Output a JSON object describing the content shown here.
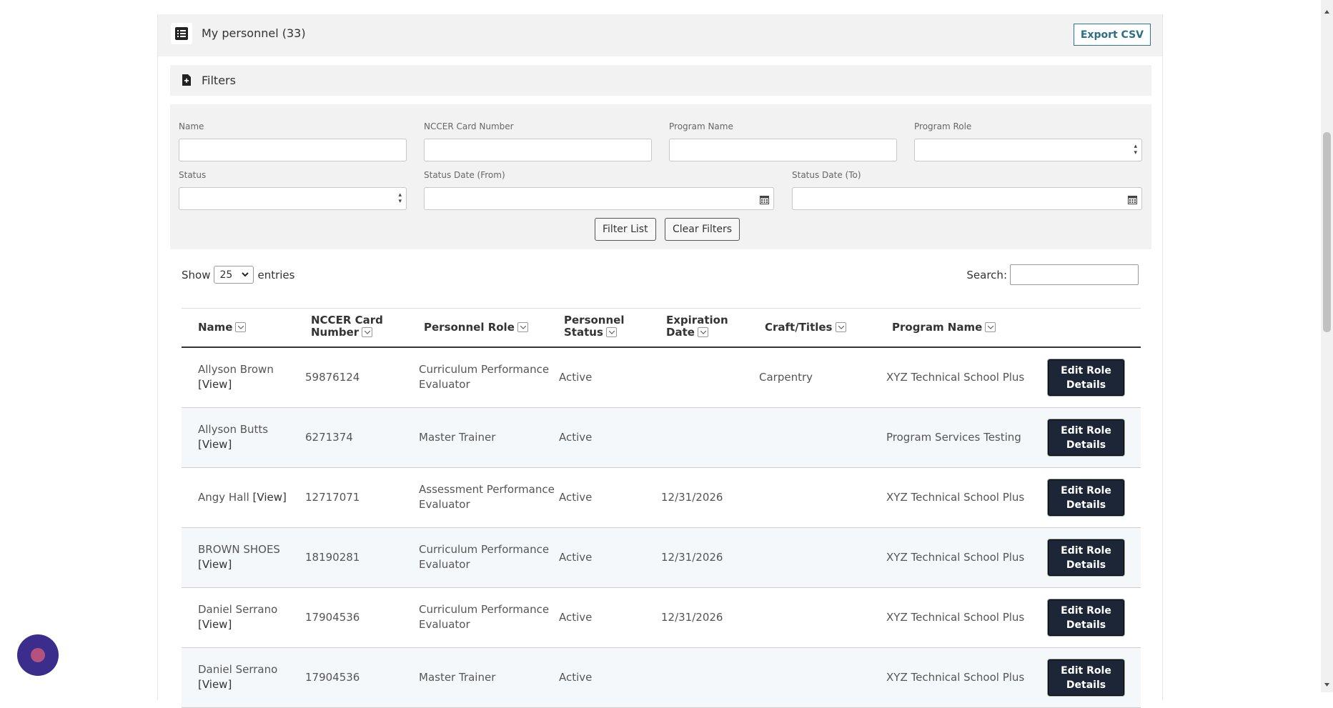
{
  "header": {
    "title": "My personnel (33)",
    "export_label": "Export CSV"
  },
  "filters": {
    "title": "Filters",
    "name_label": "Name",
    "card_label": "NCCER Card Number",
    "program_name_label": "Program Name",
    "program_role_label": "Program Role",
    "status_label": "Status",
    "date_from_label": "Status Date (From)",
    "date_to_label": "Status Date (To)",
    "filter_button": "Filter List",
    "clear_button": "Clear Filters"
  },
  "table_controls": {
    "show_label": "Show",
    "page_length": "25",
    "entries_label": "entries",
    "search_label": "Search:"
  },
  "columns": {
    "name": "Name",
    "card_1": "NCCER Card",
    "card_2": "Number",
    "role": "Personnel Role",
    "status_1": "Personnel",
    "status_2": "Status",
    "exp_1": "Expiration",
    "exp_2": "Date",
    "craft": "Craft/Titles",
    "program": "Program Name"
  },
  "rows": [
    {
      "name": "Allyson Brown",
      "view": "[View]",
      "card": "59876124",
      "role_1": "Curriculum Performance",
      "role_2": "Evaluator",
      "status": "Active",
      "expiration": "",
      "craft": "Carpentry",
      "program": "XYZ Technical School Plus",
      "action_1": "Edit Role",
      "action_2": "Details"
    },
    {
      "name": "Allyson Butts",
      "view": "[View]",
      "card": "6271374",
      "role_1": "Master Trainer",
      "role_2": "",
      "status": "Active",
      "expiration": "",
      "craft": "",
      "program": "Program Services Testing",
      "action_1": "Edit Role",
      "action_2": "Details"
    },
    {
      "name": "Angy Hall",
      "view": "[View]",
      "card": "12717071",
      "role_1": "Assessment Performance",
      "role_2": "Evaluator",
      "status": "Active",
      "expiration": "12/31/2026",
      "craft": "",
      "program": "XYZ Technical School Plus",
      "action_1": "Edit Role",
      "action_2": "Details"
    },
    {
      "name": "BROWN SHOES",
      "view": "[View]",
      "card": "18190281",
      "role_1": "Curriculum Performance",
      "role_2": "Evaluator",
      "status": "Active",
      "expiration": "12/31/2026",
      "craft": "",
      "program": "XYZ Technical School Plus",
      "action_1": "Edit Role",
      "action_2": "Details"
    },
    {
      "name": "Daniel Serrano",
      "view": "[View]",
      "card": "17904536",
      "role_1": "Curriculum Performance",
      "role_2": "Evaluator",
      "status": "Active",
      "expiration": "12/31/2026",
      "craft": "",
      "program": "XYZ Technical School Plus",
      "action_1": "Edit Role",
      "action_2": "Details"
    },
    {
      "name": "Daniel Serrano",
      "view": "[View]",
      "card": "17904536",
      "role_1": "Master Trainer",
      "role_2": "",
      "status": "Active",
      "expiration": "",
      "craft": "",
      "program": "XYZ Technical School Plus",
      "action_1": "Edit Role",
      "action_2": "Details"
    }
  ],
  "colors": {
    "header_bg": "#f2f2f2",
    "button_dark": "#1c2636",
    "export_accent": "#2b6f86",
    "chat_bubble": "#3b2d8c"
  },
  "icons": {
    "header": "list-icon",
    "filters": "file-icon",
    "calendar": "calendar-icon",
    "chat": "chat-icon"
  }
}
